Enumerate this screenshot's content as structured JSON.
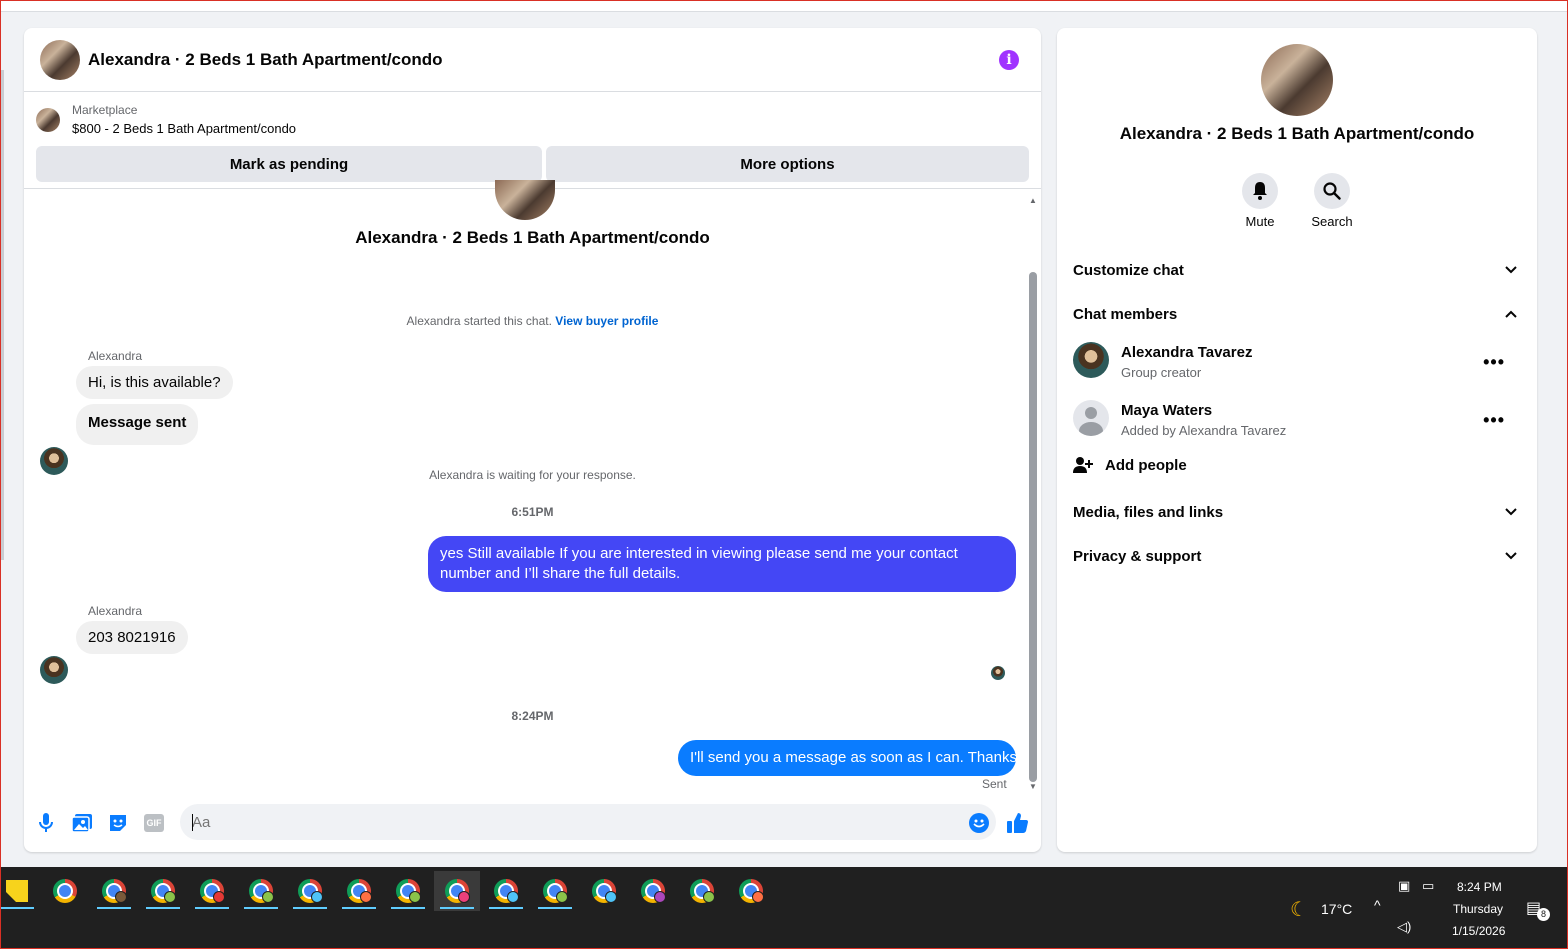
{
  "chat": {
    "title": "Alexandra · 2 Beds 1 Bath Apartment/condo",
    "marketplace": {
      "label": "Marketplace",
      "listing": "$800 - 2 Beds 1 Bath Apartment/condo",
      "pending_button": "Mark as pending",
      "more_button": "More options"
    },
    "thread_title": "Alexandra · 2 Beds 1 Bath Apartment/condo",
    "started_note": "Alexandra started this chat.",
    "buyer_profile_link": "View buyer profile",
    "messages": [
      {
        "sender": "Alexandra",
        "text": "Hi, is this available?"
      },
      {
        "text": "Message sent"
      },
      {
        "system": "Alexandra is waiting for your response."
      },
      {
        "time": "6:51PM"
      },
      {
        "outgoing": "yes Still available If you are interested in viewing please send me your contact number and I’ll share the full details."
      },
      {
        "sender": "Alexandra",
        "text": "203 8021916"
      },
      {
        "time": "8:24PM"
      },
      {
        "outgoing": "I'll send you a message as soon as I can. Thanks"
      }
    ],
    "sent_status": "Sent",
    "composer_placeholder": "Aa",
    "gif_label": "GIF"
  },
  "side": {
    "title": "Alexandra · 2 Beds 1 Bath Apartment/condo",
    "mute_label": "Mute",
    "search_label": "Search",
    "customize": "Customize chat",
    "members_heading": "Chat members",
    "members": [
      {
        "name": "Alexandra Tavarez",
        "sub": "Group creator"
      },
      {
        "name": "Maya Waters",
        "sub": "Added by Alexandra Tavarez"
      }
    ],
    "add_people": "Add people",
    "media": "Media, files and links",
    "privacy": "Privacy & support"
  },
  "taskbar": {
    "weather": "17°C",
    "time": "8:24 PM",
    "day": "Thursday",
    "date": "1/15/2026",
    "notification_count": "8"
  },
  "colors": {
    "accent_blue": "#0a7cff",
    "outgoing_purple": "#4447f5",
    "info_purple": "#a033ff",
    "link": "#0064d1"
  }
}
